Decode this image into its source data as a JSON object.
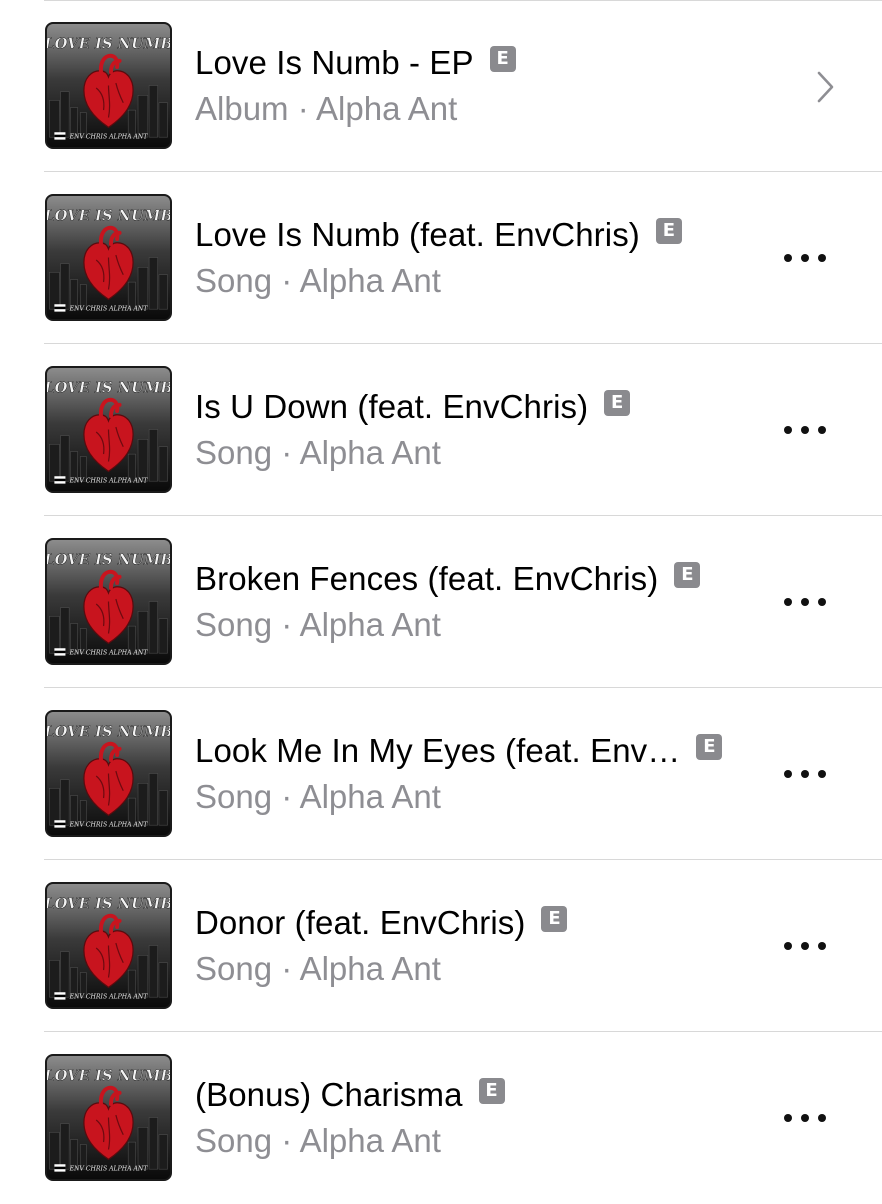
{
  "results": [
    {
      "title": "Love Is Numb - EP",
      "subtitle": "Album · Alpha Ant",
      "explicit_badge": "E",
      "accessory": "chevron-right-icon",
      "artwork": {
        "title_text": "LOVE IS NUMB",
        "artists_text": "ENV CHRIS  ALPHA ANT"
      }
    },
    {
      "title": "Love Is Numb (feat. EnvChris)",
      "subtitle": "Song · Alpha Ant",
      "explicit_badge": "E",
      "accessory": "more-options-icon",
      "artwork": {
        "title_text": "LOVE IS NUMB",
        "artists_text": "ENV CHRIS  ALPHA ANT"
      }
    },
    {
      "title": "Is U Down (feat. EnvChris)",
      "subtitle": "Song · Alpha Ant",
      "explicit_badge": "E",
      "accessory": "more-options-icon",
      "artwork": {
        "title_text": "LOVE IS NUMB",
        "artists_text": "ENV CHRIS  ALPHA ANT"
      }
    },
    {
      "title": "Broken Fences (feat. EnvChris)",
      "subtitle": "Song · Alpha Ant",
      "explicit_badge": "E",
      "accessory": "more-options-icon",
      "artwork": {
        "title_text": "LOVE IS NUMB",
        "artists_text": "ENV CHRIS  ALPHA ANT"
      }
    },
    {
      "title": "Look Me In My Eyes (feat. Env…",
      "subtitle": "Song · Alpha Ant",
      "explicit_badge": "E",
      "accessory": "more-options-icon",
      "artwork": {
        "title_text": "LOVE IS NUMB",
        "artists_text": "ENV CHRIS  ALPHA ANT"
      }
    },
    {
      "title": "Donor (feat. EnvChris)",
      "subtitle": "Song · Alpha Ant",
      "explicit_badge": "E",
      "accessory": "more-options-icon",
      "artwork": {
        "title_text": "LOVE IS NUMB",
        "artists_text": "ENV CHRIS  ALPHA ANT"
      }
    },
    {
      "title": "(Bonus) Charisma",
      "subtitle": "Song · Alpha Ant",
      "explicit_badge": "E",
      "accessory": "more-options-icon",
      "artwork": {
        "title_text": "LOVE IS NUMB",
        "artists_text": "ENV CHRIS  ALPHA ANT"
      }
    }
  ],
  "colors": {
    "title": "#000000",
    "subtitle": "#8e8e93",
    "badge_bg": "#8a8a8e",
    "divider": "#d8d8d8",
    "artwork_heart": "#c8141e"
  }
}
